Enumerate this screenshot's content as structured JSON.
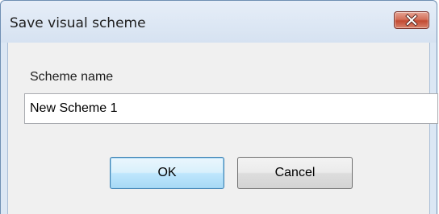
{
  "window": {
    "title": "Save visual scheme"
  },
  "close_button": {
    "icon": "close-icon"
  },
  "form": {
    "scheme_name_label": "Scheme name",
    "scheme_name_value": "New Scheme 1"
  },
  "buttons": {
    "ok_label": "OK",
    "cancel_label": "Cancel"
  },
  "colors": {
    "close_button": "#c24a33",
    "default_button_border": "#3c7fb1"
  }
}
